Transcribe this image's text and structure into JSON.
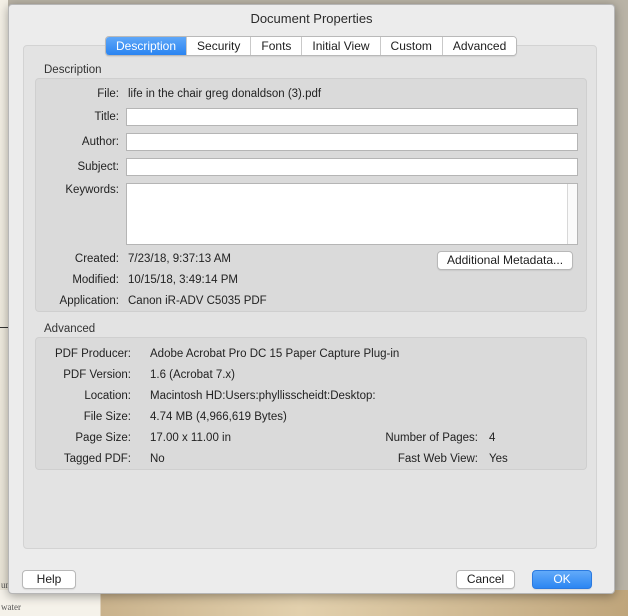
{
  "dialog": {
    "title": "Document Properties"
  },
  "tabs": [
    "Description",
    "Security",
    "Fonts",
    "Initial View",
    "Custom",
    "Advanced"
  ],
  "description": {
    "group_label": "Description",
    "file_label": "File:",
    "file_value": "life in the chair greg donaldson (3).pdf",
    "title_label": "Title:",
    "title_value": "",
    "author_label": "Author:",
    "author_value": "",
    "subject_label": "Subject:",
    "subject_value": "",
    "keywords_label": "Keywords:",
    "keywords_value": "",
    "created_label": "Created:",
    "created_value": "7/23/18, 9:37:13 AM",
    "modified_label": "Modified:",
    "modified_value": "10/15/18, 3:49:14 PM",
    "application_label": "Application:",
    "application_value": "Canon iR-ADV C5035  PDF",
    "metadata_button": "Additional Metadata..."
  },
  "advanced": {
    "group_label": "Advanced",
    "producer_label": "PDF Producer:",
    "producer_value": "Adobe Acrobat Pro DC 15 Paper Capture Plug-in",
    "version_label": "PDF Version:",
    "version_value": "1.6 (Acrobat 7.x)",
    "location_label": "Location:",
    "location_value": "Macintosh HD:Users:phyllisscheidt:Desktop:",
    "filesize_label": "File Size:",
    "filesize_value": "4.74 MB (4,966,619 Bytes)",
    "pagesize_label": "Page Size:",
    "pagesize_value": "17.00 x 11.00 in",
    "pages_label": "Number of Pages:",
    "pages_value": "4",
    "tagged_label": "Tagged PDF:",
    "tagged_value": "No",
    "fastweb_label": "Fast Web View:",
    "fastweb_value": "Yes"
  },
  "buttons": {
    "help": "Help",
    "cancel": "Cancel",
    "ok": "OK"
  },
  "background_text": {
    "line1": "under",
    "line2": "water"
  },
  "colors": {
    "accent": "#2a84f1",
    "dialog_bg": "#ececec"
  }
}
